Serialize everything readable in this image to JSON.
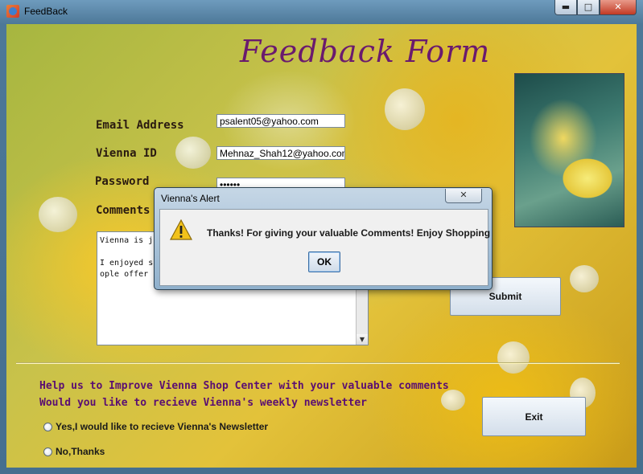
{
  "window": {
    "title": "FeedBack",
    "controls": {
      "minimize": "▬",
      "maximize": "□",
      "close": "✕"
    }
  },
  "form": {
    "title": "Feedback Form",
    "email_label": "Email Address",
    "email_value": "psalent05@yahoo.com",
    "vienna_id_label": "Vienna ID",
    "vienna_id_value": "Mehnaz_Shah12@yahoo.com",
    "password_label": "Password",
    "password_value": "••••••",
    "comments_label": "Comments",
    "comments_text": "Vienna is just\n\nI enjoyed sho\nople offer is",
    "submit_label": "Submit",
    "exit_label": "Exit"
  },
  "newsletter": {
    "line1": "Help us to Improve Vienna Shop Center with your valuable comments",
    "line2": "Would you like to recieve Vienna's weekly newsletter",
    "option_yes": "Yes,I would like to recieve Vienna's Newsletter",
    "option_no": "No,Thanks"
  },
  "dialog": {
    "title": "Vienna's Alert",
    "message": "Thanks! For giving your valuable Comments! Enjoy Shopping",
    "ok_label": "OK",
    "close_glyph": "✕",
    "icon": "warning-icon"
  },
  "colors": {
    "title_purple": "#6a1a6e",
    "newsletter_purple": "#5a0e72",
    "warning_yellow": "#f2c21b"
  }
}
